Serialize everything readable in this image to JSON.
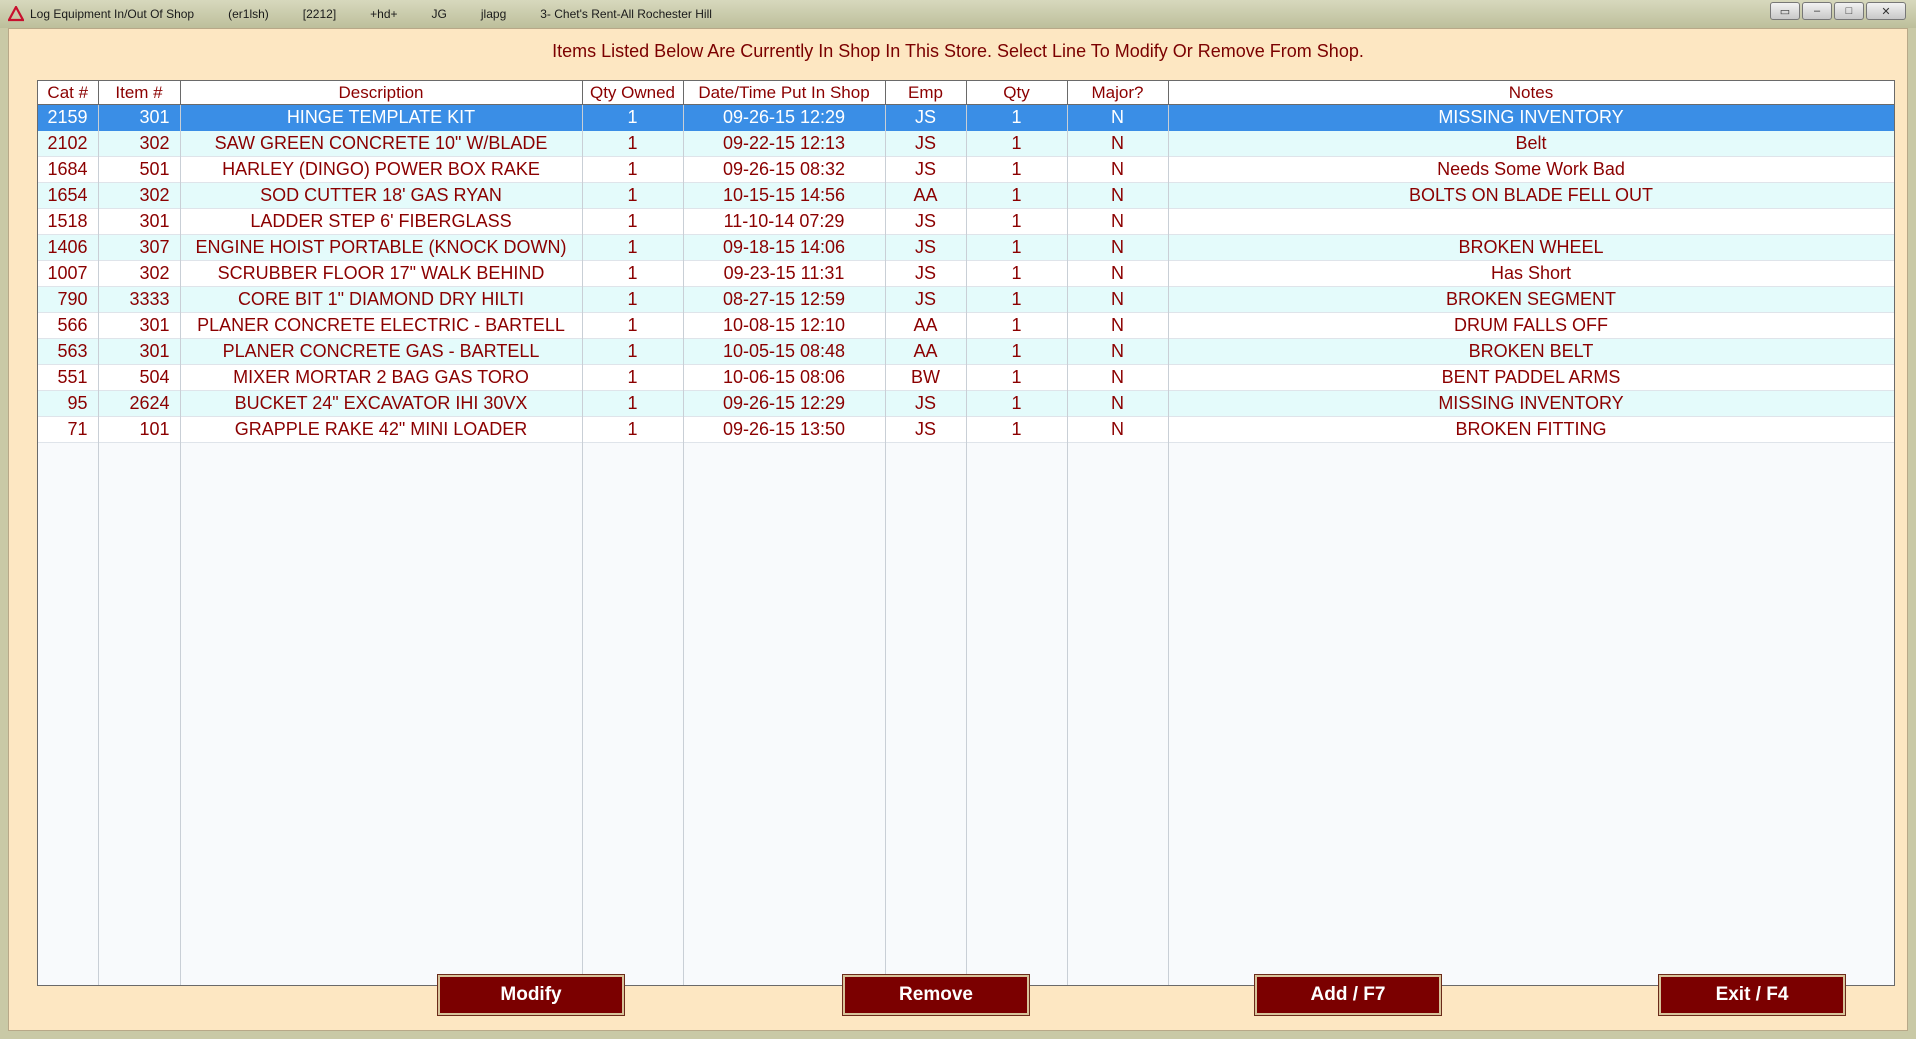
{
  "window": {
    "title_segments": [
      "Log Equipment In/Out Of Shop",
      "(er1lsh)",
      "[2212]",
      "+hd+",
      "JG",
      "jlapg",
      "3-   Chet's Rent-All Rochester Hill"
    ],
    "controls": {
      "restore": "▭",
      "minimize": "–",
      "maximize": "□",
      "close": "✕"
    }
  },
  "instruction": "Items Listed Below Are Currently In Shop In This Store.  Select Line To Modify Or Remove From Shop.",
  "table": {
    "columns": [
      "Cat #",
      "Item #",
      "Description",
      "Qty Owned",
      "Date/Time Put In Shop",
      "Emp",
      "Qty",
      "Major?",
      "Notes"
    ],
    "selected_row": 0,
    "rows": [
      [
        "2159",
        "301",
        "HINGE TEMPLATE KIT",
        "1",
        "09-26-15 12:29",
        "JS",
        "1",
        "N",
        "MISSING INVENTORY"
      ],
      [
        "2102",
        "302",
        "SAW GREEN CONCRETE 10\" W/BLADE",
        "1",
        "09-22-15 12:13",
        "JS",
        "1",
        "N",
        "Belt"
      ],
      [
        "1684",
        "501",
        "HARLEY (DINGO) POWER BOX RAKE",
        "1",
        "09-26-15 08:32",
        "JS",
        "1",
        "N",
        "Needs Some Work Bad"
      ],
      [
        "1654",
        "302",
        "SOD CUTTER 18' GAS RYAN",
        "1",
        "10-15-15 14:56",
        "AA",
        "1",
        "N",
        "BOLTS ON BLADE FELL OUT"
      ],
      [
        "1518",
        "301",
        "LADDER STEP 6' FIBERGLASS",
        "1",
        "11-10-14 07:29",
        "JS",
        "1",
        "N",
        ""
      ],
      [
        "1406",
        "307",
        "ENGINE HOIST PORTABLE (KNOCK DOWN)",
        "1",
        "09-18-15 14:06",
        "JS",
        "1",
        "N",
        "BROKEN WHEEL"
      ],
      [
        "1007",
        "302",
        "SCRUBBER FLOOR 17\" WALK BEHIND",
        "1",
        "09-23-15 11:31",
        "JS",
        "1",
        "N",
        "Has Short"
      ],
      [
        "790",
        "3333",
        "CORE BIT 1\" DIAMOND DRY HILTI",
        "1",
        "08-27-15 12:59",
        "JS",
        "1",
        "N",
        "BROKEN SEGMENT"
      ],
      [
        "566",
        "301",
        "PLANER CONCRETE ELECTRIC - BARTELL",
        "1",
        "10-08-15 12:10",
        "AA",
        "1",
        "N",
        "DRUM FALLS OFF"
      ],
      [
        "563",
        "301",
        "PLANER CONCRETE GAS - BARTELL",
        "1",
        "10-05-15 08:48",
        "AA",
        "1",
        "N",
        "BROKEN BELT"
      ],
      [
        "551",
        "504",
        "MIXER MORTAR 2 BAG GAS TORO",
        "1",
        "10-06-15 08:06",
        "BW",
        "1",
        "N",
        "BENT PADDEL ARMS"
      ],
      [
        "95",
        "2624",
        "BUCKET 24\" EXCAVATOR IHI 30VX",
        "1",
        "09-26-15 12:29",
        "JS",
        "1",
        "N",
        "MISSING INVENTORY"
      ],
      [
        "71",
        "101",
        "GRAPPLE RAKE 42\" MINI LOADER",
        "1",
        "09-26-15 13:50",
        "JS",
        "1",
        "N",
        "BROKEN FITTING"
      ]
    ]
  },
  "buttons": {
    "modify": "Modify",
    "remove": "Remove",
    "add": "Add / F7",
    "exit": "Exit / F4"
  },
  "colors": {
    "text": "#8b0000",
    "client_bg": "#fde7c2",
    "selected_row": "#3a8ee6",
    "alt_row": "#e4fbfb",
    "button_bg": "#7b0000"
  }
}
